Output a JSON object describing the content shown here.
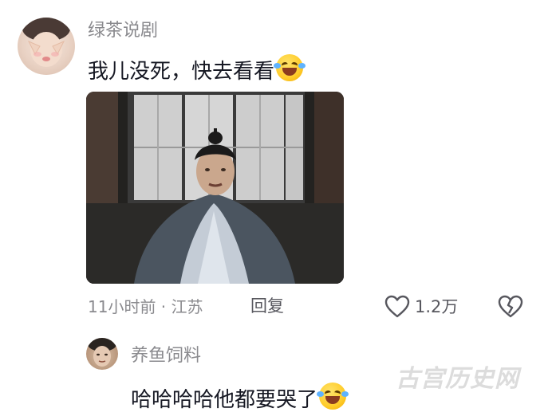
{
  "comment": {
    "username": "绿茶说剧",
    "text": "我儿没死，快去看看",
    "emoji": "laugh-cry-emoji",
    "time_location": "11小时前 · 江苏",
    "reply_label": "回复",
    "like_count": "1.2万"
  },
  "reply": {
    "username": "养鱼饲料",
    "text": "哈哈哈哈他都要哭了",
    "emoji": "laugh-cry-emoji"
  },
  "watermark": "古宫历史网"
}
